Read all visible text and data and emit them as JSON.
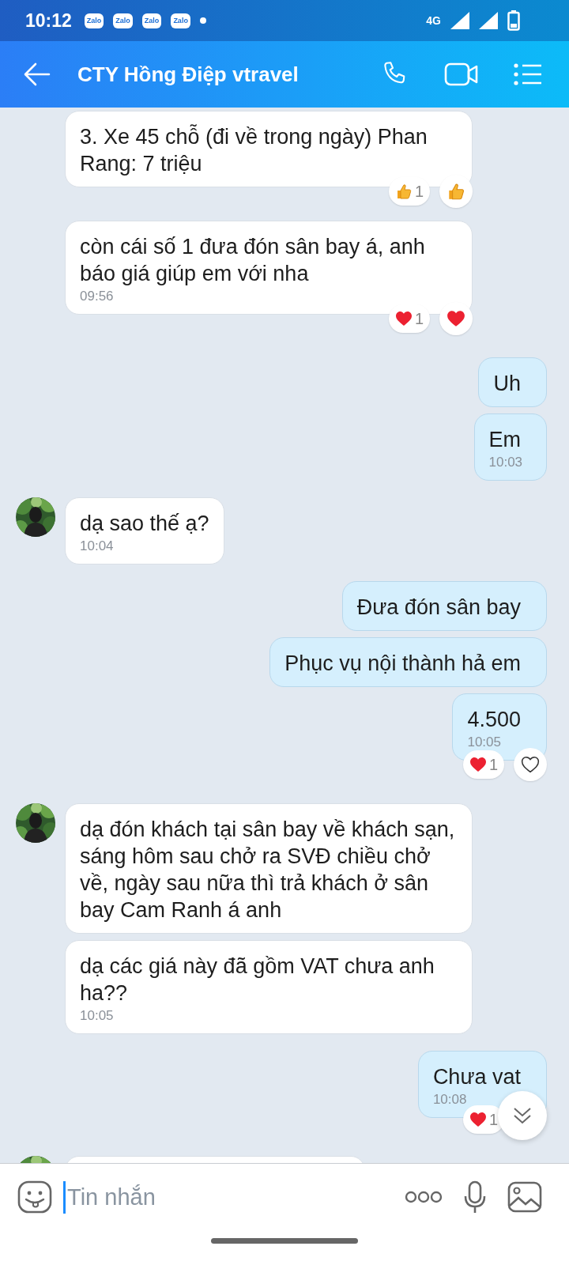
{
  "status_bar": {
    "time": "10:12",
    "notifications": [
      "Zalo",
      "Zalo",
      "Zalo",
      "Zalo"
    ],
    "network": "4G"
  },
  "header": {
    "title": "CTY Hồng Điệp vtravel"
  },
  "messages": [
    {
      "outgoing": false,
      "avatar": false,
      "text": "3. Xe 45 chỗ (đi về trong ngày) Phan Rang: 7 triệu",
      "reactions": [
        {
          "kind": "like",
          "count": "1"
        }
      ],
      "react_button": {
        "kind": "like"
      }
    },
    {
      "outgoing": false,
      "avatar": false,
      "text": "còn cái số 1 đưa đón sân bay á, anh báo giá giúp em với nha",
      "time": "09:56",
      "reactions": [
        {
          "kind": "heart",
          "count": "1"
        }
      ],
      "react_button": {
        "kind": "heart"
      }
    },
    {
      "outgoing": true,
      "avatar": false,
      "text": "Uh"
    },
    {
      "outgoing": true,
      "avatar": false,
      "text": "Em",
      "time": "10:03"
    },
    {
      "outgoing": false,
      "avatar": true,
      "text": "dạ sao thế ạ?",
      "time": "10:04"
    },
    {
      "outgoing": true,
      "avatar": false,
      "text": "Đưa đón sân bay"
    },
    {
      "outgoing": true,
      "avatar": false,
      "text": "Phục vụ nội thành hả em"
    },
    {
      "outgoing": true,
      "avatar": false,
      "text": "4.500",
      "time": "10:05",
      "reactions": [
        {
          "kind": "heart",
          "count": "1"
        }
      ],
      "react_button": {
        "kind": "heart_outline"
      }
    },
    {
      "outgoing": false,
      "avatar": true,
      "text": "dạ đón khách tại sân bay về khách sạn, sáng hôm sau chở ra SVĐ chiều chở về, ngày sau nữa thì trả khách ở sân bay Cam Ranh á anh"
    },
    {
      "outgoing": false,
      "avatar": false,
      "text": "dạ các giá này đã gồm VAT chưa anh ha??",
      "time": "10:05"
    },
    {
      "outgoing": true,
      "avatar": false,
      "text": "Chưa vat",
      "time": "10:08",
      "reactions": [
        {
          "kind": "heart",
          "count": "1"
        }
      ]
    },
    {
      "outgoing": false,
      "avatar": true
    }
  ],
  "composer": {
    "placeholder": "Tin nhắn"
  }
}
